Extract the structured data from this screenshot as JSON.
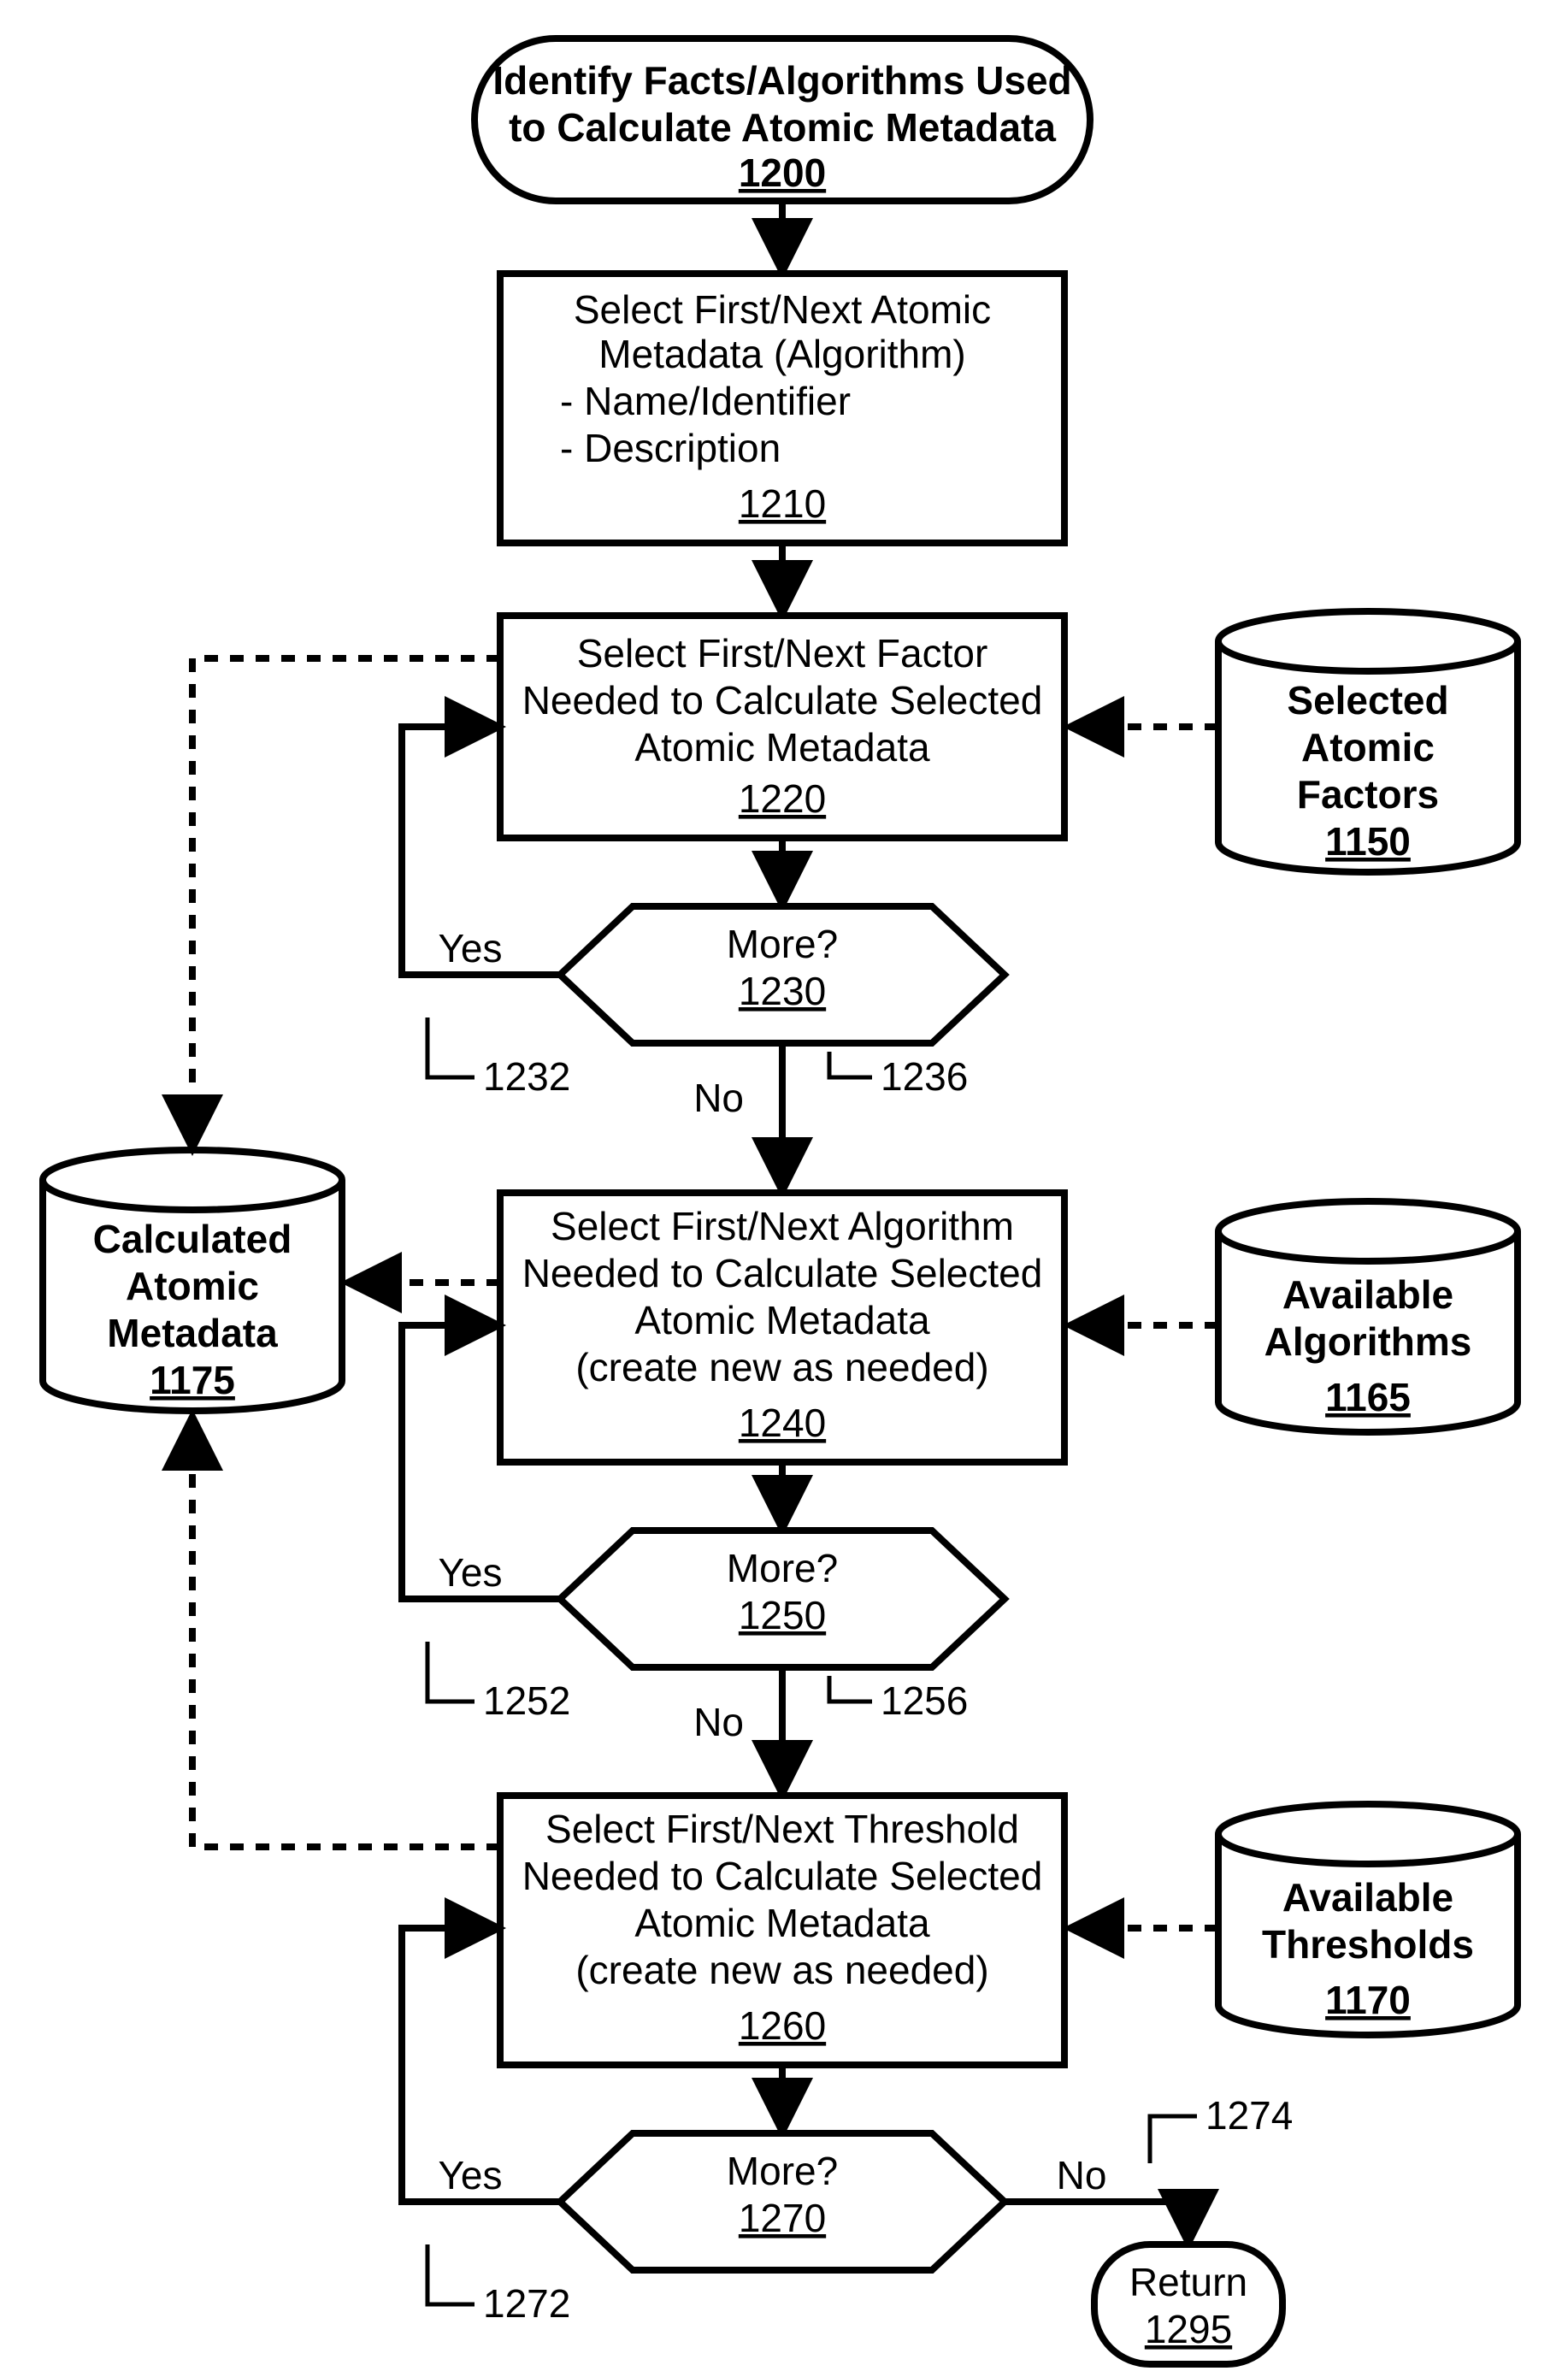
{
  "terminator_start": {
    "line1": "Identify Facts/Algorithms Used",
    "line2": "to Calculate Atomic Metadata",
    "ref": "1200"
  },
  "process_1210": {
    "line1": "Select First/Next Atomic",
    "line2": "Metadata (Algorithm)",
    "bullet1": "- Name/Identifier",
    "bullet2": "- Description",
    "ref": "1210"
  },
  "process_1220": {
    "line1": "Select First/Next Factor",
    "line2": "Needed to Calculate Selected",
    "line3": "Atomic Metadata",
    "ref": "1220"
  },
  "decision_1230": {
    "label": "More?",
    "ref": "1230",
    "yes": "Yes",
    "no": "No",
    "yes_ref": "1232",
    "no_ref": "1236"
  },
  "process_1240": {
    "line1": "Select First/Next Algorithm",
    "line2": "Needed to Calculate Selected",
    "line3": "Atomic Metadata",
    "line4": "(create new as needed)",
    "ref": "1240"
  },
  "decision_1250": {
    "label": "More?",
    "ref": "1250",
    "yes": "Yes",
    "no": "No",
    "yes_ref": "1252",
    "no_ref": "1256"
  },
  "process_1260": {
    "line1": "Select First/Next Threshold",
    "line2": "Needed to Calculate Selected",
    "line3": "Atomic Metadata",
    "line4": "(create new as needed)",
    "ref": "1260"
  },
  "decision_1270": {
    "label": "More?",
    "ref": "1270",
    "yes": "Yes",
    "no": "No",
    "yes_ref": "1272",
    "no_ref": "1274"
  },
  "terminator_return": {
    "label": "Return",
    "ref": "1295"
  },
  "cyl_1150": {
    "line1": "Selected",
    "line2": "Atomic",
    "line3": "Factors",
    "ref": "1150"
  },
  "cyl_1165": {
    "line1": "Available",
    "line2": "Algorithms",
    "ref": "1165"
  },
  "cyl_1170": {
    "line1": "Available",
    "line2": "Thresholds",
    "ref": "1170"
  },
  "cyl_1175": {
    "line1": "Calculated",
    "line2": "Atomic",
    "line3": "Metadata",
    "ref": "1175"
  }
}
